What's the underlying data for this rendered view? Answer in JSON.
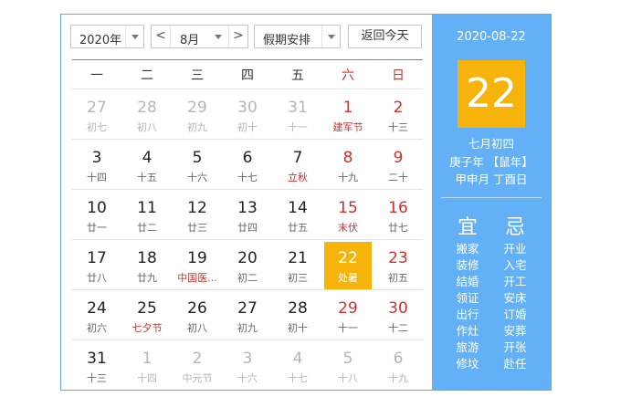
{
  "toolbar": {
    "year": "2020年",
    "prev_month": "<",
    "month": "8月",
    "next_month": ">",
    "holiday": "假期安排",
    "back_today": "返回今天"
  },
  "weekdays": [
    "一",
    "二",
    "三",
    "四",
    "五",
    "六",
    "日"
  ],
  "weeks": [
    [
      {
        "n": "27",
        "l": "初七",
        "cls": "other"
      },
      {
        "n": "28",
        "l": "初八",
        "cls": "other"
      },
      {
        "n": "29",
        "l": "初九",
        "cls": "other"
      },
      {
        "n": "30",
        "l": "初十",
        "cls": "other"
      },
      {
        "n": "31",
        "l": "十一",
        "cls": "other"
      },
      {
        "n": "1",
        "l": "建军节",
        "cls": "weekend festival"
      },
      {
        "n": "2",
        "l": "十三",
        "cls": "weekend"
      }
    ],
    [
      {
        "n": "3",
        "l": "十四",
        "cls": ""
      },
      {
        "n": "4",
        "l": "十五",
        "cls": ""
      },
      {
        "n": "5",
        "l": "十六",
        "cls": ""
      },
      {
        "n": "6",
        "l": "十七",
        "cls": ""
      },
      {
        "n": "7",
        "l": "立秋",
        "cls": "festival"
      },
      {
        "n": "8",
        "l": "十九",
        "cls": "weekend"
      },
      {
        "n": "9",
        "l": "二十",
        "cls": "weekend"
      }
    ],
    [
      {
        "n": "10",
        "l": "廿一",
        "cls": ""
      },
      {
        "n": "11",
        "l": "廿二",
        "cls": ""
      },
      {
        "n": "12",
        "l": "廿三",
        "cls": ""
      },
      {
        "n": "13",
        "l": "廿四",
        "cls": ""
      },
      {
        "n": "14",
        "l": "廿五",
        "cls": ""
      },
      {
        "n": "15",
        "l": "末伏",
        "cls": "weekend festival"
      },
      {
        "n": "16",
        "l": "廿七",
        "cls": "weekend"
      }
    ],
    [
      {
        "n": "17",
        "l": "廿八",
        "cls": ""
      },
      {
        "n": "18",
        "l": "廿九",
        "cls": ""
      },
      {
        "n": "19",
        "l": "中国医...",
        "cls": "festival"
      },
      {
        "n": "20",
        "l": "初二",
        "cls": ""
      },
      {
        "n": "21",
        "l": "初三",
        "cls": ""
      },
      {
        "n": "22",
        "l": "处暑",
        "cls": "today"
      },
      {
        "n": "23",
        "l": "初五",
        "cls": "weekend"
      }
    ],
    [
      {
        "n": "24",
        "l": "初六",
        "cls": ""
      },
      {
        "n": "25",
        "l": "七夕节",
        "cls": "festival"
      },
      {
        "n": "26",
        "l": "初八",
        "cls": ""
      },
      {
        "n": "27",
        "l": "初九",
        "cls": ""
      },
      {
        "n": "28",
        "l": "初十",
        "cls": ""
      },
      {
        "n": "29",
        "l": "十一",
        "cls": "weekend"
      },
      {
        "n": "30",
        "l": "十二",
        "cls": "weekend"
      }
    ],
    [
      {
        "n": "31",
        "l": "十三",
        "cls": ""
      },
      {
        "n": "1",
        "l": "十四",
        "cls": "other"
      },
      {
        "n": "2",
        "l": "中元节",
        "cls": "other"
      },
      {
        "n": "3",
        "l": "十六",
        "cls": "other"
      },
      {
        "n": "4",
        "l": "十七",
        "cls": "other"
      },
      {
        "n": "5",
        "l": "十八",
        "cls": "other"
      },
      {
        "n": "6",
        "l": "十九",
        "cls": "other"
      }
    ]
  ],
  "detail": {
    "date": "2020-08-22",
    "day": "22",
    "lunar": "七月初四",
    "ganzhi_year": "庚子年 【鼠年】",
    "ganzhi_month_day": "甲申月 丁酉日",
    "yi_label": "宜",
    "ji_label": "忌",
    "yi": [
      "搬家",
      "装修",
      "结婚",
      "领证",
      "出行",
      "作灶",
      "旅游",
      "修坟"
    ],
    "ji": [
      "开业",
      "入宅",
      "开工",
      "安床",
      "订婚",
      "安葬",
      "开张",
      "赴任"
    ]
  }
}
